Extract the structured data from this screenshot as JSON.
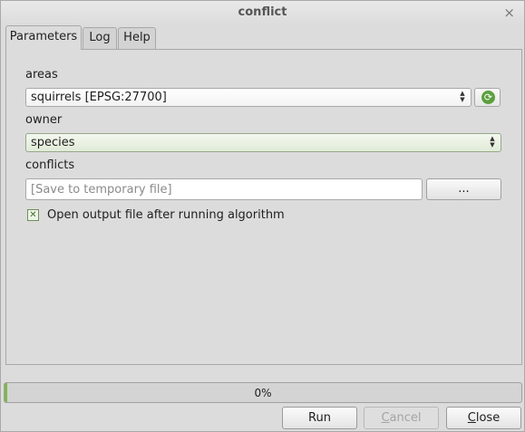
{
  "window": {
    "title": "conflict",
    "close_glyph": "×"
  },
  "tabs": [
    {
      "label": "Parameters",
      "active": true
    },
    {
      "label": "Log",
      "active": false
    },
    {
      "label": "Help",
      "active": false
    }
  ],
  "params": {
    "areas_label": "areas",
    "areas_value": "squirrels [EPSG:27700]",
    "owner_label": "owner",
    "owner_value": "species",
    "conflicts_label": "conflicts",
    "conflicts_placeholder": "[Save to temporary file]",
    "browse_label": "...",
    "open_output_label": "Open output file after running algorithm",
    "open_output_checked": true
  },
  "progress": {
    "text": "0%",
    "value": 0
  },
  "buttons": {
    "run": "Run",
    "cancel_first": "C",
    "cancel_rest": "ancel",
    "close_first": "C",
    "close_rest": "lose"
  },
  "icons": {
    "refresh": "refresh-icon",
    "checkbox": "checkbox-checked-icon",
    "close": "close-icon",
    "spinner": "spinner-arrows-icon"
  },
  "colors": {
    "accent_green": "#5aa03c",
    "owner_highlight": "#e1ebd8",
    "progress_fill": "#7db84a"
  }
}
